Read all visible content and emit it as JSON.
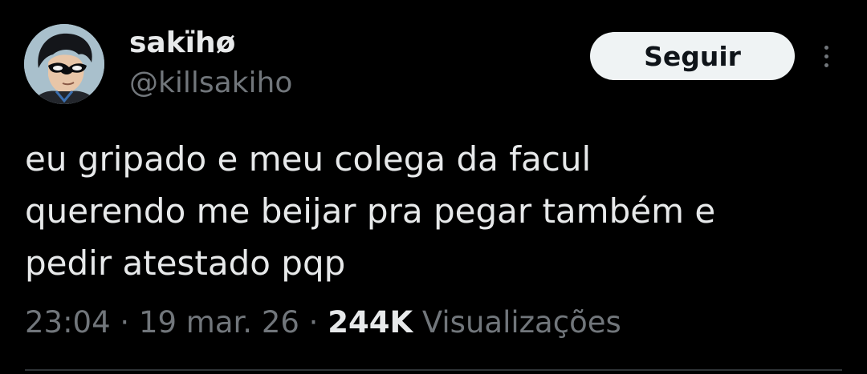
{
  "author": {
    "display_name": "sakïhø",
    "handle": "@killsakiho"
  },
  "follow_button": {
    "label": "Seguir"
  },
  "more_button": {
    "icon": "more-vertical-icon"
  },
  "tweet": {
    "text_lines": [
      "eu gripado e meu colega da facul",
      "querendo me beijar pra pegar também e",
      "pedir atestado pqp"
    ]
  },
  "meta": {
    "time": "23:04",
    "separator": " · ",
    "date": "19 mar. 26",
    "views_count": "244K",
    "views_label": "Visualizações"
  },
  "colors": {
    "background": "#000000",
    "text_primary": "#e7e9ea",
    "text_secondary": "#71767b",
    "button_bg": "#eff3f4"
  }
}
